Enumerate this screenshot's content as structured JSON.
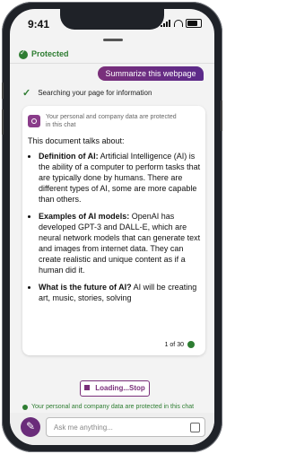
{
  "status": {
    "time": "9:41"
  },
  "header": {
    "protected": "Protected"
  },
  "prompt": {
    "label": "Summarize this webpage"
  },
  "progress": {
    "searching": "Searching your page for information"
  },
  "card": {
    "privacy": "Your personal and company data are protected in this chat",
    "lead": "This document talks about:",
    "items": [
      {
        "title": "Definition of AI:",
        "text": " Artificial Intelligence (AI) is the ability of a computer to perform tasks that are typically done by humans. There are different types of AI, some are more capable than others."
      },
      {
        "title": "Examples of AI models:",
        "text": " OpenAI has developed GPT-3 and DALL-E, which are neural network models that can generate text and images from internet data. They can create realistic and unique content as if a human did it."
      },
      {
        "title": "What is the future of AI?",
        "text": " AI will be creating art, music, stories, solving"
      }
    ],
    "pager": "1 of 30"
  },
  "controls": {
    "loading_stop": "Loading...Stop"
  },
  "footer": {
    "privacy": "Your personal and company data are protected in this chat"
  },
  "composer": {
    "placeholder": "Ask me anything..."
  },
  "colors": {
    "accent": "#7a2f7a",
    "success": "#2e7d32"
  }
}
